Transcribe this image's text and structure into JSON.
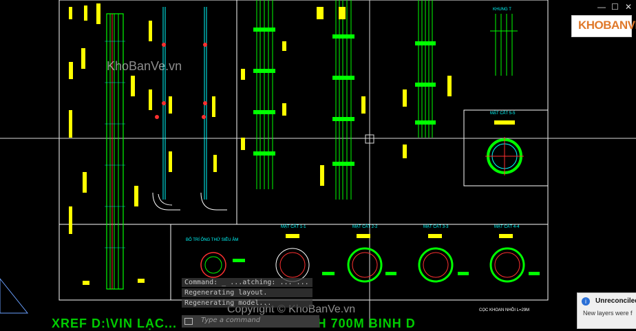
{
  "watermarks": {
    "top": "KhoBanVe.vn",
    "bottom": "Copyright © KhoBanVe.vn"
  },
  "logo": {
    "text": "KHOBANVE"
  },
  "drawing": {
    "title_khung": "KHUNG T",
    "mat_cat_55": "MẶT CẮT 5-5",
    "mat_cat_11": "MẶT CẮT 1-1",
    "mat_cat_22": "MẶT CẮT 2-2",
    "mat_cat_33": "MẶT CẮT 3-3",
    "mat_cat_44": "MẶT CẮT 4-4",
    "bo_tri": "BỐ TRÍ ỐNG THỬ SIÊU ÂM",
    "coc_khoan": "CỌC KHOAN NHỒI L=29M",
    "bottom_title": "XREF D:\\VIN LẠC... BINH DINH THAT SINH 700M BINH D"
  },
  "command_line": {
    "history": [
      "Command: _ ...atching: ... ...",
      "Regenerating layout.",
      "Regenerating model..."
    ],
    "placeholder": "Type a command"
  },
  "notification": {
    "title": "Unreconciled",
    "body": "New layers were f"
  },
  "colors": {
    "bg": "#000000",
    "rebar": "#00ff00",
    "dim": "#ffff00",
    "frame": "#ffffff",
    "accent": "#ff3030",
    "cyan": "#00ffff"
  }
}
